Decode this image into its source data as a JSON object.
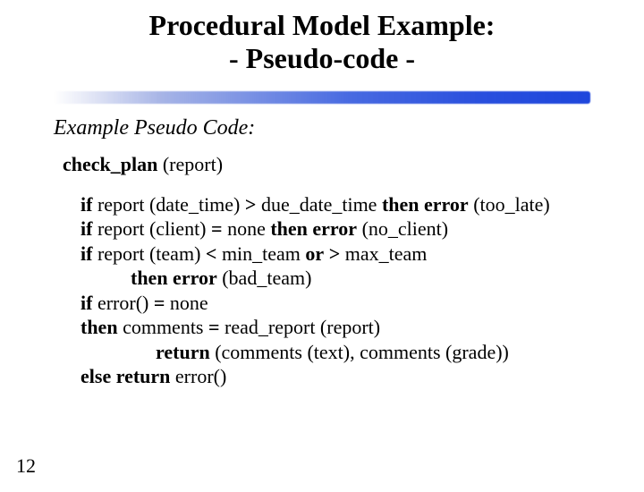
{
  "title_line1": "Procedural Model Example:",
  "title_line2": "- Pseudo-code -",
  "subheading": "Example Pseudo Code:",
  "fn_name": "check_plan",
  "fn_args": " (report)",
  "code": {
    "l1_kw1": "if",
    "l1_mid": " report (date_time) ",
    "l1_op": ">",
    "l1_mid2": " due_date_time ",
    "l1_kw2": "then error",
    "l1_tail": " (too_late)",
    "l2_kw1": "if",
    "l2_mid": " report (client) ",
    "l2_op": "=",
    "l2_mid2": " none ",
    "l2_kw2": "then error",
    "l2_tail": " (no_client)",
    "l3_kw1": "if",
    "l3_mid": " report (team) ",
    "l3_op1": "<",
    "l3_mid2": " min_team ",
    "l3_or": "or",
    "l3_sp": " ",
    "l3_op2": ">",
    "l3_tail": " max_team",
    "l4_kw": "then error",
    "l4_tail": " (bad_team)",
    "l5_kw1": "if",
    "l5_mid": " error() ",
    "l5_op": "=",
    "l5_tail": " none",
    "l6_kw": "then",
    "l6_tail": " comments ",
    "l6_op": "=",
    "l6_tail2": " read_report (report)",
    "l7_kw": "return",
    "l7_tail": " (comments (text), comments (grade))",
    "l8_kw": "else return",
    "l8_tail": " error()"
  },
  "page_number": "12"
}
